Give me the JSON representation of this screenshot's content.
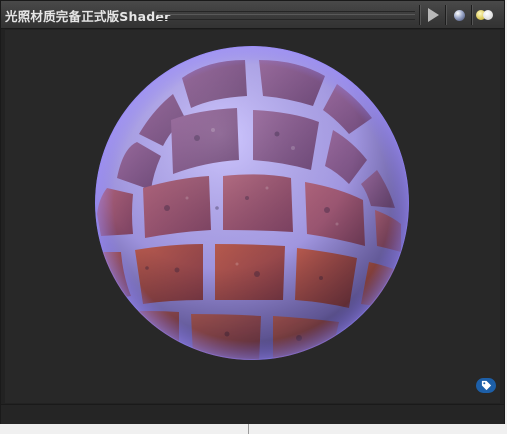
{
  "window": {
    "title": "光照材质完备正式版Shader"
  },
  "toolbar": {
    "play_icon": "play-icon",
    "sphere_icon": "preview-sphere-icon",
    "lights_icon": "preview-lights-icon"
  },
  "preview": {
    "object": "sphere",
    "texture": "brick-wall",
    "tint": "#7a6bff",
    "background": "#282828"
  },
  "badge": {
    "icon": "tag-icon",
    "color": "#1d5fa8"
  }
}
